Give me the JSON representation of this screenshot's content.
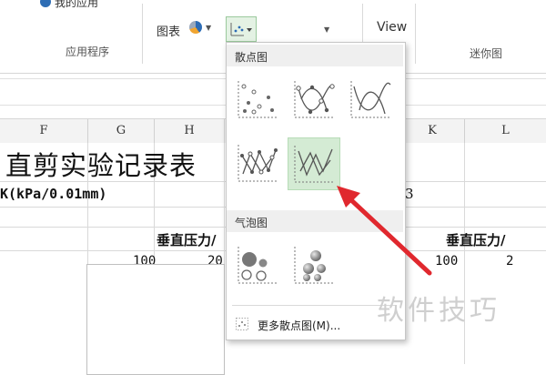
{
  "ribbon": {
    "apps_top_label": "我的应用",
    "apps_group_label": "应用程序",
    "chart_button_label": "图表",
    "view_button_label": "View",
    "sparklines_group_label": "迷你图",
    "icons": [
      "store-icon",
      "pie-chart-icon",
      "scatter-chart-icon",
      "chevron-down-icon"
    ]
  },
  "columns": [
    "F",
    "G",
    "H",
    "K",
    "L"
  ],
  "sheet": {
    "title": "直剪实验记录表",
    "k_label": "K(kPa/0.01mm)",
    "row2_value": "3",
    "vertical_pressure_left": "垂直压力/",
    "vertical_pressure_right": "垂直压力/",
    "value_left_1": "100",
    "value_left_2": "20",
    "value_right_1": "100",
    "value_right_2": "2"
  },
  "menu": {
    "scatter_section": "散点图",
    "bubble_section": "气泡图",
    "more_label": "更多散点图(M)...",
    "scatter_options": [
      "scatter-markers-only",
      "scatter-smooth-lines-markers",
      "scatter-smooth-lines",
      "scatter-straight-lines-markers",
      "scatter-straight-lines"
    ],
    "selected_option": "scatter-straight-lines",
    "bubble_options": [
      "bubble",
      "bubble-3d"
    ]
  },
  "watermark": "软件技巧",
  "colors": {
    "selection_bg": "#d4ebd4",
    "arrow": "#e0282e",
    "accent_blue": "#2d6cb5"
  }
}
